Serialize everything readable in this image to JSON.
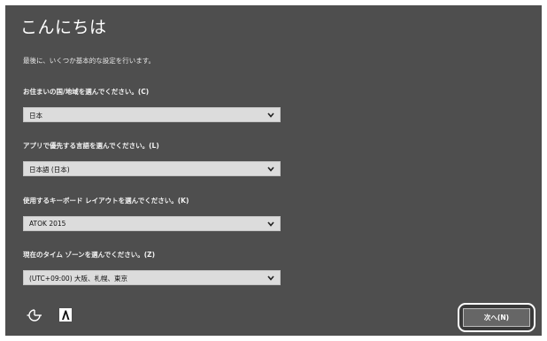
{
  "header": {
    "title": "こんにちは",
    "subtitle": "最後に、いくつか基本的な設定を行います。"
  },
  "fields": [
    {
      "label": "お住まいの国/地域を選んでください。(C)",
      "value": "日本"
    },
    {
      "label": "アプリで優先する言語を選んでください。(L)",
      "value": "日本語 (日本)"
    },
    {
      "label": "使用するキーボード レイアウトを選んでください。(K)",
      "value": "ATOK 2015"
    },
    {
      "label": "現在のタイム ゾーンを選んでください。(Z)",
      "value": "(UTC+09:00) 大阪、札幌、東京"
    }
  ],
  "footer": {
    "next_label": "次へ(N)",
    "icons": [
      "ease-of-access-icon",
      "input-method-icon"
    ]
  },
  "colors": {
    "background": "#4e4e4e",
    "dropdown": "#dcdcdc",
    "button": "#666666"
  }
}
